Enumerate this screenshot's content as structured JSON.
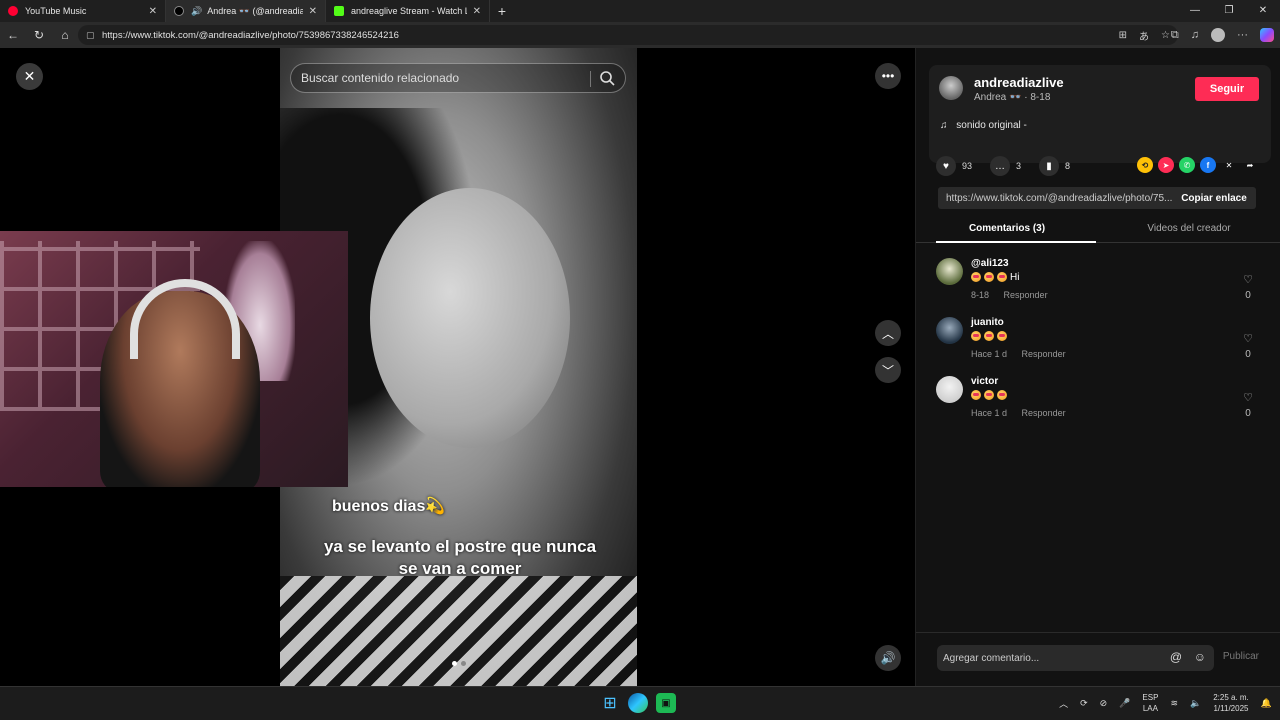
{
  "browser": {
    "tabs": [
      {
        "title": "YouTube Music",
        "color": "#ff0033"
      },
      {
        "title": "Andrea 👓 (@andreadiazlive",
        "color": "#000000"
      },
      {
        "title": "andreaglive Stream - Watch Live",
        "color": "#53fc18"
      }
    ],
    "url": "https://www.tiktok.com/@andreadiazlive/photo/7539867338246524216"
  },
  "viewer": {
    "search_placeholder": "Buscar contenido relacionado",
    "caption_line1": "buenos dias💫",
    "caption_line2": "ya se levanto el postre que nunca se van a comer"
  },
  "creator": {
    "username": "andreadiazlive",
    "subtitle": "Andrea 👓 · 8-18",
    "follow_label": "Seguir",
    "sound": "sonido original -"
  },
  "stats": {
    "likes": "93",
    "comments": "3",
    "saves": "8"
  },
  "link": {
    "url": "https://www.tiktok.com/@andreadiazlive/photo/75...",
    "copy_label": "Copiar enlace"
  },
  "tabs": {
    "comments": "Comentarios (3)",
    "videos": "Videos del creador"
  },
  "comments": [
    {
      "user": "@ali123",
      "text": "Hi",
      "meta": "8-18",
      "reply": "Responder",
      "likes": "0"
    },
    {
      "user": "juanito",
      "text": "",
      "meta": "Hace 1 d",
      "reply": "Responder",
      "likes": "0"
    },
    {
      "user": "victor",
      "text": "",
      "meta": "Hace 1 d",
      "reply": "Responder",
      "likes": "0"
    }
  ],
  "composer": {
    "placeholder": "Agregar comentario...",
    "publish_label": "Publicar"
  },
  "taskbar": {
    "lang_line1": "ESP",
    "lang_line2": "LAA",
    "time": "2:25 a. m.",
    "date": "1/11/2025"
  },
  "colors": {
    "accent_follow": "#fe2c55",
    "panel_bg": "#121212"
  }
}
